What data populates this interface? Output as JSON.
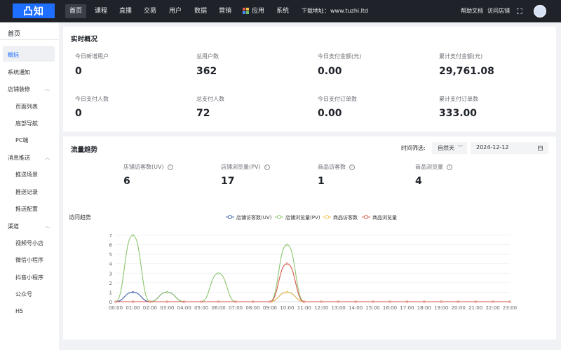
{
  "header": {
    "logo": "凸知",
    "nav": [
      "首页",
      "课程",
      "直播",
      "交易",
      "用户",
      "数据",
      "营销",
      "应用",
      "系统"
    ],
    "download_label": "下载地址：",
    "download_url": "www.tuzhi.ltd",
    "help": "帮助文档",
    "visit_store": "访问店铺"
  },
  "sidebar": {
    "title": "首页",
    "items": [
      "概括",
      "系统通知",
      "店铺装修",
      "页面列表",
      "底部导航",
      "PC端",
      "消息推送",
      "推送场景",
      "推送记录",
      "推送配置",
      "渠道",
      "视频号小店",
      "微信小程序",
      "抖音小程序",
      "公众号",
      "H5"
    ]
  },
  "overview": {
    "title": "实时概况",
    "stats": [
      {
        "label": "今日新增用户",
        "value": "0"
      },
      {
        "label": "总用户数",
        "value": "362"
      },
      {
        "label": "今日支付金额(元)",
        "value": "0.00"
      },
      {
        "label": "累计支付金额(元)",
        "value": "29,761.08"
      },
      {
        "label": "今日支付人数",
        "value": "0"
      },
      {
        "label": "总支付人数",
        "value": "72"
      },
      {
        "label": "今日支付订单数",
        "value": "0.00"
      },
      {
        "label": "累计支付订单数",
        "value": "333.00"
      }
    ]
  },
  "traffic": {
    "title": "流量趋势",
    "filter_label": "时间筛选:",
    "filter_value": "自然天",
    "date": "2024-12-12",
    "metrics": [
      {
        "label": "店铺访客数(UV)",
        "value": "6"
      },
      {
        "label": "店铺浏览量(PV)",
        "value": "17"
      },
      {
        "label": "商品访客数",
        "value": "1"
      },
      {
        "label": "商品浏览量",
        "value": "4"
      }
    ]
  },
  "chart_data": {
    "type": "line",
    "title": "访问趋势",
    "categories": [
      "00:00",
      "01:00",
      "02:00",
      "03:00",
      "04:00",
      "05:00",
      "06:00",
      "07:00",
      "08:00",
      "09:00",
      "10:00",
      "11:00",
      "12:00",
      "13:00",
      "14:00",
      "15:00",
      "16:00",
      "17:00",
      "18:00",
      "19:00",
      "20:00",
      "21:00",
      "22:00",
      "23:00"
    ],
    "series": [
      {
        "name": "店铺访客数(UV)",
        "color": "#3e5fb2",
        "values": [
          0,
          1,
          0,
          1,
          0,
          0,
          0,
          0,
          0,
          0,
          1,
          0,
          0,
          0,
          0,
          0,
          0,
          0,
          0,
          0,
          0,
          0,
          0,
          0
        ]
      },
      {
        "name": "店铺浏览量(PV)",
        "color": "#8bc56b",
        "values": [
          0,
          7,
          0,
          1,
          0,
          0,
          3,
          0,
          0,
          0,
          6,
          0,
          0,
          0,
          0,
          0,
          0,
          0,
          0,
          0,
          0,
          0,
          0,
          0
        ]
      },
      {
        "name": "商品访客数",
        "color": "#f3c14a",
        "values": [
          0,
          0,
          0,
          0,
          0,
          0,
          0,
          0,
          0,
          0,
          1,
          0,
          0,
          0,
          0,
          0,
          0,
          0,
          0,
          0,
          0,
          0,
          0,
          0
        ]
      },
      {
        "name": "商品浏览量",
        "color": "#d9574b",
        "values": [
          0,
          0,
          0,
          0,
          0,
          0,
          0,
          0,
          0,
          0,
          4,
          0,
          0,
          0,
          0,
          0,
          0,
          0,
          0,
          0,
          0,
          0,
          0,
          0
        ]
      }
    ],
    "yticks": [
      "0",
      "1",
      "2",
      "3",
      "4",
      "5",
      "6",
      "7"
    ],
    "ylim": [
      0,
      7
    ],
    "grid": true,
    "legend": "top-center"
  }
}
